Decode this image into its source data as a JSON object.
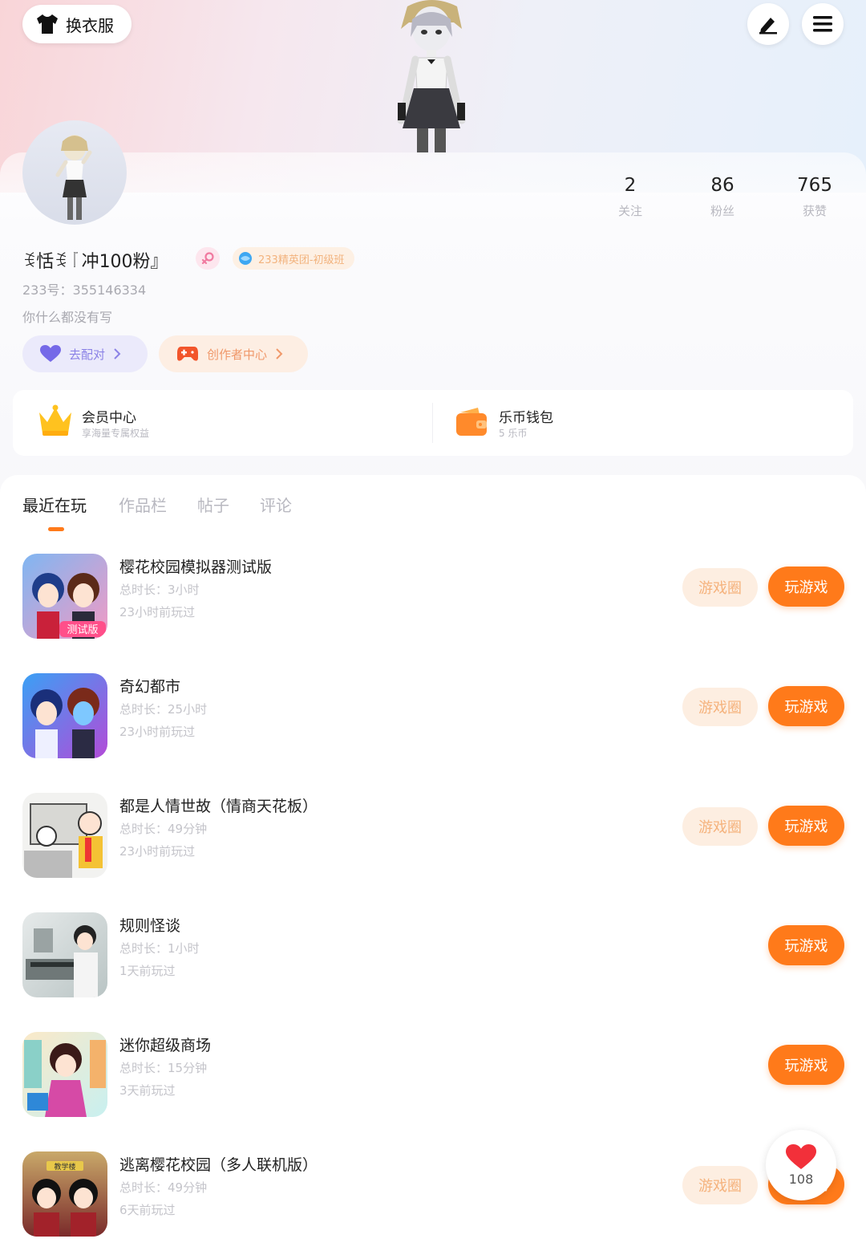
{
  "header": {
    "outfit_label": "换衣服",
    "edit_icon": "pencil-icon",
    "menu_icon": "hamburger-menu-icon"
  },
  "profile": {
    "stats": [
      {
        "value": "2",
        "label": "关注"
      },
      {
        "value": "86",
        "label": "粉丝"
      },
      {
        "value": "765",
        "label": "获赞"
      }
    ],
    "nickname": "ꉂ恬ꉂ『冲100粉』",
    "member_badge": "233精英团-初级班",
    "uid": "233号：355146334",
    "bio": "你什么都没有写",
    "pair_button": "去配对",
    "creator_button": "创作者中心"
  },
  "quick_links": {
    "vip": {
      "title": "会员中心",
      "subtitle": "享海量专属权益"
    },
    "wallet": {
      "title": "乐币钱包",
      "subtitle": "5 乐币"
    }
  },
  "tabs": [
    "最近在玩",
    "作品栏",
    "帖子",
    "评论"
  ],
  "games": [
    {
      "name": "樱花校园模拟器测试版",
      "duration": "总时长：3小时",
      "last": "23小时前玩过",
      "circle": "游戏圈",
      "play": "玩游戏"
    },
    {
      "name": "奇幻都市",
      "duration": "总时长：25小时",
      "last": "23小时前玩过",
      "circle": "游戏圈",
      "play": "玩游戏"
    },
    {
      "name": "都是人情世故（情商天花板）",
      "duration": "总时长：49分钟",
      "last": "23小时前玩过",
      "circle": "游戏圈",
      "play": "玩游戏"
    },
    {
      "name": "规则怪谈",
      "duration": "总时长：1小时",
      "last": "1天前玩过",
      "play": "玩游戏"
    },
    {
      "name": "迷你超级商场",
      "duration": "总时长：15分钟",
      "last": "3天前玩过",
      "play": "玩游戏"
    },
    {
      "name": "逃离樱花校园（多人联机版）",
      "duration": "总时长：49分钟",
      "last": "6天前玩过",
      "circle": "游戏圈",
      "play": "玩游戏"
    }
  ],
  "thumb_labels": {
    "g0": "测试版",
    "g5": "教学楼"
  },
  "like_fab": {
    "count": "108"
  },
  "colors": {
    "accent": "#ff7a1a",
    "circle_bg": "#fdeee1",
    "circle_text": "#f5b27c"
  }
}
